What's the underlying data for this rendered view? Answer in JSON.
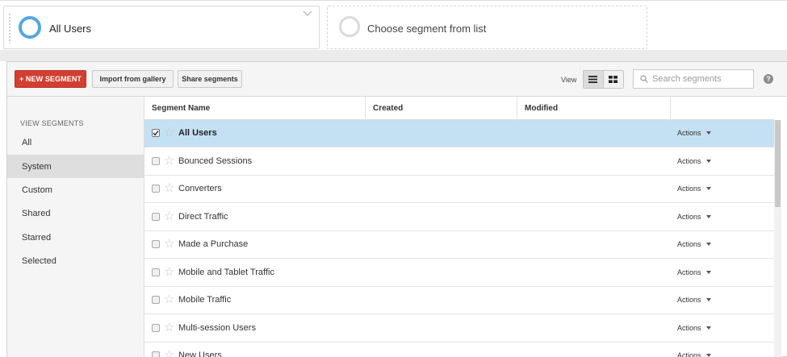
{
  "segments": {
    "active": {
      "label": "All Users",
      "ring_color": "#55a7dd"
    },
    "empty": {
      "label": "Choose segment from list"
    }
  },
  "toolbar": {
    "new_segment": "+ NEW SEGMENT",
    "import": "Import from gallery",
    "share": "Share segments",
    "view_label": "View",
    "search_placeholder": "Search segments",
    "help": "?"
  },
  "sidebar": {
    "heading": "VIEW SEGMENTS",
    "items": [
      {
        "label": "All",
        "selected": false
      },
      {
        "label": "System",
        "selected": true
      },
      {
        "label": "Custom",
        "selected": false
      },
      {
        "label": "Shared",
        "selected": false
      },
      {
        "label": "Starred",
        "selected": false
      },
      {
        "label": "Selected",
        "selected": false
      }
    ]
  },
  "table": {
    "columns": [
      "Segment Name",
      "Created",
      "Modified"
    ],
    "actions_label": "Actions",
    "rows": [
      {
        "name": "All Users",
        "checked": true
      },
      {
        "name": "Bounced Sessions",
        "checked": false
      },
      {
        "name": "Converters",
        "checked": false
      },
      {
        "name": "Direct Traffic",
        "checked": false
      },
      {
        "name": "Made a Purchase",
        "checked": false
      },
      {
        "name": "Mobile and Tablet Traffic",
        "checked": false
      },
      {
        "name": "Mobile Traffic",
        "checked": false
      },
      {
        "name": "Multi-session Users",
        "checked": false
      },
      {
        "name": "New Users",
        "checked": false
      }
    ]
  },
  "colors": {
    "accent_red": "#d23f31",
    "selected_row": "#c3e1f2"
  }
}
